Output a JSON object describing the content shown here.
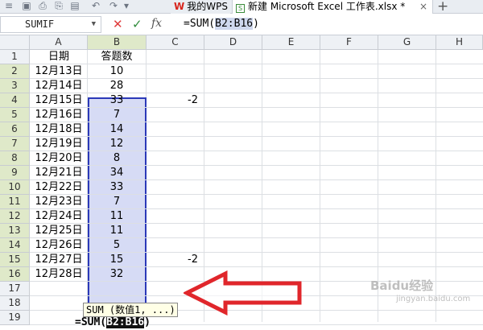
{
  "tabs": {
    "wps_label": "我的WPS",
    "doc_label": "新建 Microsoft Excel 工作表.xlsx *",
    "close_glyph": "×",
    "new_tab_glyph": "+"
  },
  "formula_bar": {
    "name_box": "SUMIF",
    "cancel_glyph": "✕",
    "enter_glyph": "✓",
    "fx_label": "fx",
    "formula_prefix": "=SUM(",
    "formula_range": "B2:B16",
    "formula_suffix": ")"
  },
  "columns": [
    "A",
    "B",
    "C",
    "D",
    "E",
    "F",
    "G",
    "H"
  ],
  "rows": [
    "1",
    "2",
    "3",
    "4",
    "5",
    "6",
    "7",
    "8",
    "9",
    "10",
    "11",
    "12",
    "13",
    "14",
    "15",
    "16",
    "17",
    "18",
    "19"
  ],
  "header": {
    "a1": "日期",
    "b1": "答题数"
  },
  "dates": [
    "12月13日",
    "12月14日",
    "12月15日",
    "12月16日",
    "12月18日",
    "12月19日",
    "12月20日",
    "12月21日",
    "12月22日",
    "12月23日",
    "12月24日",
    "12月25日",
    "12月26日",
    "12月27日",
    "12月28日"
  ],
  "counts": [
    "10",
    "28",
    "33",
    "7",
    "14",
    "12",
    "8",
    "34",
    "33",
    "7",
    "11",
    "11",
    "5",
    "15",
    "32"
  ],
  "c_values": {
    "c4": "-2",
    "c15": "-2"
  },
  "edit_cell": {
    "prefix": "=SUM(",
    "range": "B2:B16",
    "suffix": ")"
  },
  "tooltip": "SUM (数值1, ...)",
  "watermark": {
    "main": "Baidu经验",
    "sub": "jingyan.baidu.com"
  },
  "colors": {
    "accent_red": "#e0262b",
    "range_border": "#2b39b8",
    "range_fill": "#d6dbf5"
  }
}
